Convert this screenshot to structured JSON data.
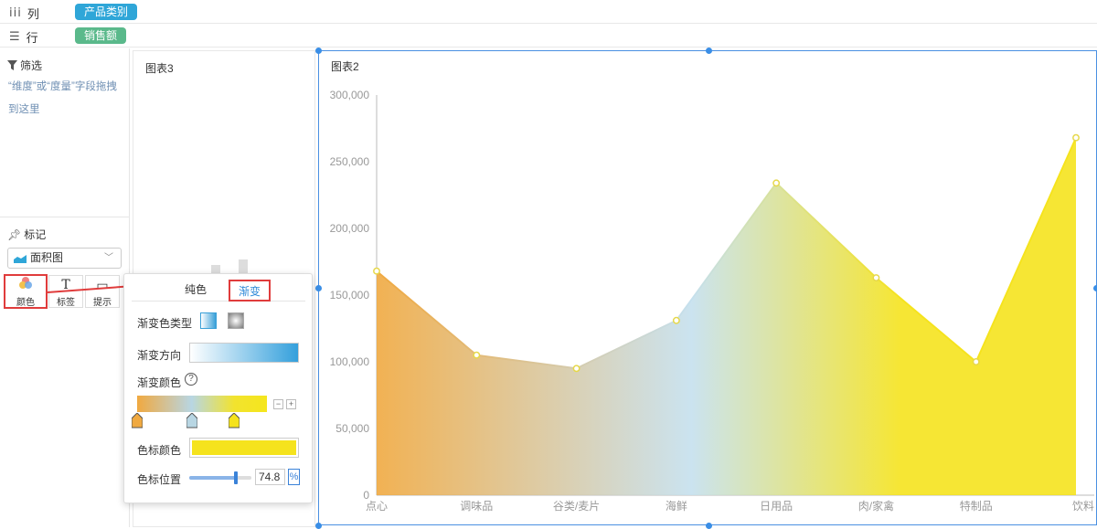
{
  "shelves": {
    "columns": {
      "icon": "bar-columns-icon",
      "label": "列",
      "pill": "产品类别"
    },
    "rows": {
      "icon": "list-rows-icon",
      "label": "行",
      "pill": "销售额"
    }
  },
  "sidebar": {
    "filter_title": "筛选",
    "filter_hint": "“维度”或“度量”字段拖拽到这里",
    "mark_title": "标记",
    "chart_type": "面积图",
    "buttons": {
      "color": "颜色",
      "label": "标签",
      "tooltip": "提示"
    }
  },
  "panel3": {
    "title": "图表3"
  },
  "popup": {
    "tabs": {
      "solid": "纯色",
      "gradient": "渐变"
    },
    "gradient_type_label": "渐变色类型",
    "gradient_direction_label": "渐变方向",
    "gradient_color_label": "渐变颜色",
    "help": "?",
    "minus": "−",
    "plus": "+",
    "stop_color_label": "色标颜色",
    "stop_position_label": "色标位置",
    "stop_position_value": "74.8",
    "stop_position_unit": "%",
    "stops": [
      {
        "color": "#f0a940",
        "pos": 0
      },
      {
        "color": "#b8d6e3",
        "pos": 42
      },
      {
        "color": "#f5e31d",
        "pos": 74.8
      }
    ],
    "selected_stop_color": "#f5e31d"
  },
  "chart_data": {
    "type": "area",
    "title": "图表2",
    "categories": [
      "点心",
      "调味品",
      "谷类/麦片",
      "海鲜",
      "日用品",
      "肉/家禽",
      "特制品",
      "饮料"
    ],
    "values": [
      168000,
      105000,
      95000,
      131000,
      234000,
      163000,
      100000,
      268000
    ],
    "ylim": [
      0,
      300000
    ],
    "yticks": [
      "0",
      "50,000",
      "100,000",
      "150,000",
      "200,000",
      "250,000",
      "300,000"
    ],
    "gradient": [
      "#f0a940",
      "#c5e0ee",
      "#f5e31d"
    ],
    "grid": false
  }
}
